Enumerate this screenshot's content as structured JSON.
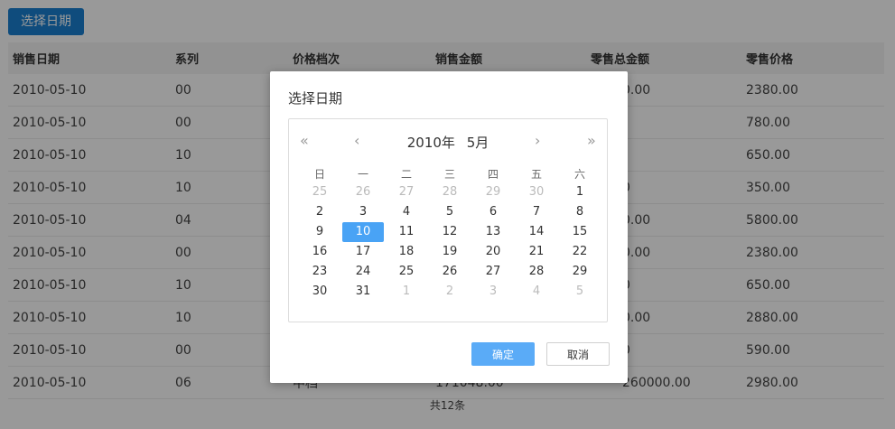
{
  "toolbar": {
    "select_date_label": "选择日期"
  },
  "table": {
    "headers": [
      "销售日期",
      "系列",
      "价格档次",
      "销售金额",
      "零售总金额",
      "零售价格"
    ],
    "rows": [
      [
        "2010-05-10",
        "00",
        "",
        "",
        "0.00",
        "2380.00"
      ],
      [
        "2010-05-10",
        "00",
        "",
        "",
        "",
        "780.00"
      ],
      [
        "2010-05-10",
        "10",
        "",
        "",
        "",
        "650.00"
      ],
      [
        "2010-05-10",
        "10",
        "",
        "",
        "0",
        "350.00"
      ],
      [
        "2010-05-10",
        "04",
        "",
        "",
        "0.00",
        "5800.00"
      ],
      [
        "2010-05-10",
        "00",
        "",
        "",
        "0.00",
        "2380.00"
      ],
      [
        "2010-05-10",
        "10",
        "",
        "",
        "0",
        "650.00"
      ],
      [
        "2010-05-10",
        "10",
        "",
        "",
        "0.00",
        "2880.00"
      ],
      [
        "2010-05-10",
        "00",
        "",
        "",
        "0",
        "590.00"
      ],
      [
        "2010-05-10",
        "06",
        "中档",
        "171048.00",
        "260000.00",
        "2980.00"
      ]
    ],
    "footer": "共12条"
  },
  "dialog": {
    "title": "选择日期",
    "calendar": {
      "year_label": "2010年",
      "month_label": "5月",
      "weekdays": [
        "日",
        "一",
        "二",
        "三",
        "四",
        "五",
        "六"
      ],
      "weeks": [
        [
          "25",
          "26",
          "27",
          "28",
          "29",
          "30",
          "1"
        ],
        [
          "2",
          "3",
          "4",
          "5",
          "6",
          "7",
          "8"
        ],
        [
          "9",
          "10",
          "11",
          "12",
          "13",
          "14",
          "15"
        ],
        [
          "16",
          "17",
          "18",
          "19",
          "20",
          "21",
          "22"
        ],
        [
          "23",
          "24",
          "25",
          "26",
          "27",
          "28",
          "29"
        ],
        [
          "30",
          "31",
          "1",
          "2",
          "3",
          "4",
          "5"
        ]
      ],
      "selected": "10"
    },
    "ok_label": "确定",
    "cancel_label": "取消"
  },
  "icons": {
    "prev_year": "«",
    "prev_month": "‹",
    "next_month": "›",
    "next_year": "»"
  }
}
